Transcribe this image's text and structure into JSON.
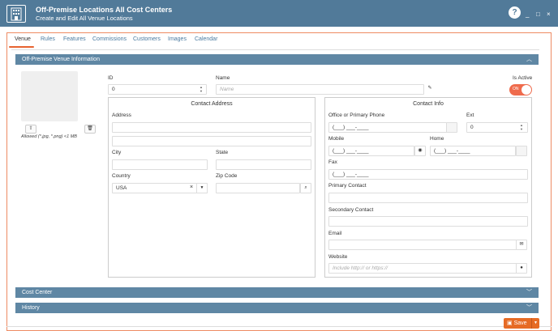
{
  "window": {
    "title": "Off-Premise Locations All Cost Centers",
    "subtitle": "Create and Edit All Venue Locations",
    "help": "?",
    "minimize": "_",
    "maximize": "□",
    "close": "×"
  },
  "tabs": [
    "Venue",
    "Rules",
    "Features",
    "Commissions",
    "Customers",
    "Images",
    "Calendar"
  ],
  "sections": {
    "venue_info": "Off-Premise Venue Information",
    "cost_center": "Cost Center",
    "history": "History"
  },
  "image": {
    "upload": "⇧",
    "delete": "🗑",
    "note": "Allowed (*.jpg, *.png) <1 MB"
  },
  "fields": {
    "id_label": "ID",
    "id_value": "0",
    "name_label": "Name",
    "name_placeholder": "Name",
    "is_active_label": "Is Active",
    "is_active_state": "ON"
  },
  "contact_address": {
    "title": "Contact Address",
    "address_label": "Address",
    "city_label": "City",
    "state_label": "State",
    "country_label": "Country",
    "country_value": "USA",
    "zip_label": "Zip Code"
  },
  "contact_info": {
    "title": "Contact Info",
    "phone_label": "Office or Primary Phone",
    "phone_value": "(___) ___-____",
    "ext_label": "Ext",
    "ext_value": "0",
    "mobile_label": "Mobile",
    "mobile_value": "(___) ___-____",
    "home_label": "Home",
    "home_value": "(___) ___-____",
    "fax_label": "Fax",
    "fax_value": "(___) ___-____",
    "primary_contact_label": "Primary Contact",
    "secondary_contact_label": "Secondary Contact",
    "email_label": "Email",
    "website_label": "Website",
    "website_placeholder": "Include http:// or https://"
  },
  "footer": {
    "save_label": "Save"
  },
  "colors": {
    "header": "#517a99",
    "section": "#5f87a4",
    "accent": "#e7622f",
    "link": "#4a7aa0"
  }
}
